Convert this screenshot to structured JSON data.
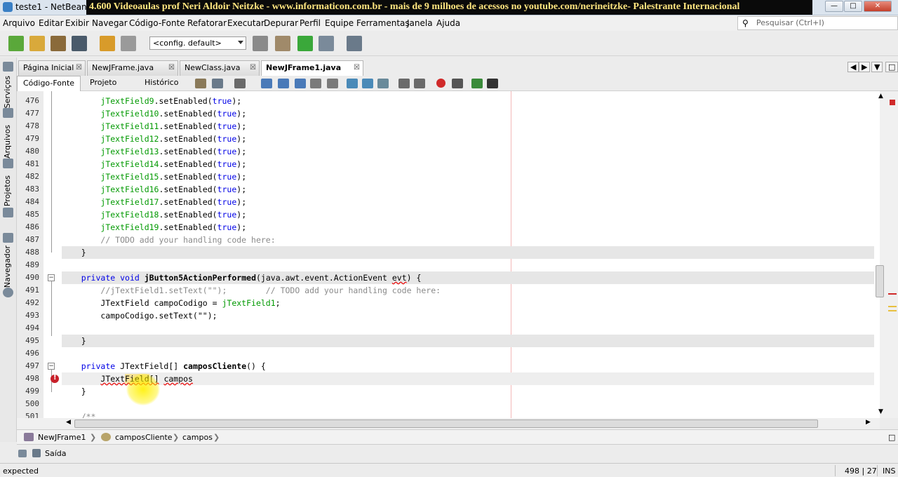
{
  "window": {
    "title": "teste1 - NetBeans I",
    "banner": "4.600 Videoaulas prof Neri Aldoir Neitzke - www.informaticon.com.br - mais de 9 milhoes de acessos no youtube.com/nerineitzke- Palestrante Internacional"
  },
  "menu": [
    "Arquivo",
    "Editar",
    "Exibir",
    "Navegar",
    "Código-Fonte",
    "Refatorar",
    "Executar",
    "Depurar",
    "Perfil",
    "Equipe",
    "Ferramentas",
    "Janela",
    "Ajuda"
  ],
  "search": {
    "placeholder": "Pesquisar (Ctrl+I)"
  },
  "toolbar": {
    "config": "<config. default>"
  },
  "side_panels": [
    "Serviços",
    "Arquivos",
    "Projetos",
    "Navegador"
  ],
  "tabs": [
    {
      "label": "Página Inicial",
      "active": false
    },
    {
      "label": "NewJFrame.java",
      "active": false
    },
    {
      "label": "NewClass.java",
      "active": false
    },
    {
      "label": "NewJFrame1.java",
      "active": true
    }
  ],
  "subtabs": [
    {
      "label": "Código-Fonte",
      "active": true
    },
    {
      "label": "Projeto",
      "active": false
    },
    {
      "label": "Histórico",
      "active": false
    }
  ],
  "code": [
    {
      "n": "476",
      "text": "        jTextField9.setEnabled(true);"
    },
    {
      "n": "477",
      "text": "        jTextField10.setEnabled(true);"
    },
    {
      "n": "478",
      "text": "        jTextField11.setEnabled(true);"
    },
    {
      "n": "479",
      "text": "        jTextField12.setEnabled(true);"
    },
    {
      "n": "480",
      "text": "        jTextField13.setEnabled(true);"
    },
    {
      "n": "481",
      "text": "        jTextField14.setEnabled(true);"
    },
    {
      "n": "482",
      "text": "        jTextField15.setEnabled(true);"
    },
    {
      "n": "483",
      "text": "        jTextField16.setEnabled(true);"
    },
    {
      "n": "484",
      "text": "        jTextField17.setEnabled(true);"
    },
    {
      "n": "485",
      "text": "        jTextField18.setEnabled(true);"
    },
    {
      "n": "486",
      "text": "        jTextField19.setEnabled(true);"
    },
    {
      "n": "487",
      "text": "        // TODO add your handling code here:"
    },
    {
      "n": "488",
      "text": "    }"
    },
    {
      "n": "489",
      "text": ""
    },
    {
      "n": "490",
      "text": "    private void jButton5ActionPerformed(java.awt.event.ActionEvent evt) {"
    },
    {
      "n": "491",
      "text": "        //jTextField1.setText(\"\");        // TODO add your handling code here:"
    },
    {
      "n": "492",
      "text": "        JTextField campoCodigo = jTextField1;"
    },
    {
      "n": "493",
      "text": "        campoCodigo.setText(\"\");"
    },
    {
      "n": "494",
      "text": ""
    },
    {
      "n": "495",
      "text": "    }"
    },
    {
      "n": "496",
      "text": ""
    },
    {
      "n": "497",
      "text": "    private JTextField[] camposCliente() {"
    },
    {
      "n": "498",
      "text": "        JTextField[] campos"
    },
    {
      "n": "499",
      "text": "    }"
    },
    {
      "n": "500",
      "text": ""
    },
    {
      "n": "501",
      "text": "    /**"
    }
  ],
  "breadcrumb": [
    "NewJFrame1",
    "camposCliente",
    "campos"
  ],
  "output": {
    "label": "Saída"
  },
  "status": {
    "message": "expected",
    "position": "498 | 27",
    "mode": "INS"
  },
  "colors": {
    "keyword": "#0000e6",
    "field": "#009900",
    "comment": "#8a8a8a",
    "banner_bg": "#0a0a0a",
    "banner_fg": "#ffe680",
    "error": "#c8202a"
  }
}
